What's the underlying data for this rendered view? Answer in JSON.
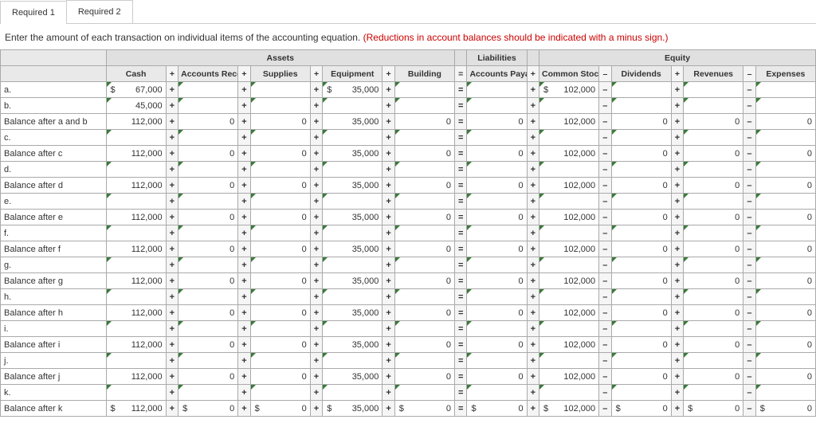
{
  "tabs": {
    "req1": "Required 1",
    "req2": "Required 2"
  },
  "instruction": "Enter the amount of each transaction on individual items of the accounting equation. ",
  "warning": "(Reductions in account balances should be indicated with a minus sign.)",
  "group_headers": {
    "assets": "Assets",
    "liabilities": "Liabilities",
    "equity": "Equity"
  },
  "cols": {
    "cash": "Cash",
    "ar": "Accounts Receivable",
    "supplies": "Supplies",
    "equip": "Equipment",
    "bldg": "Building",
    "ap": "Accounts Payable",
    "cs": "Common Stock",
    "div": "Dividends",
    "rev": "Revenues",
    "exp": "Expenses"
  },
  "ops": {
    "plus": "+",
    "minus": "–",
    "eq": "="
  },
  "currency": "$",
  "rows": [
    {
      "label": "a.",
      "cash": "67,000",
      "cash$": true,
      "ar": "",
      "sup": "",
      "equip": "35,000",
      "equip$": true,
      "bldg": "",
      "ap": "",
      "cs": "102,000",
      "cs$": true,
      "div": "",
      "rev": "",
      "exp": "",
      "tri": true
    },
    {
      "label": "b.",
      "cash": "45,000",
      "ar": "",
      "sup": "",
      "equip": "",
      "bldg": "",
      "ap": "",
      "cs": "",
      "div": "",
      "rev": "",
      "exp": "",
      "tri": true,
      "dotted": true
    },
    {
      "label": "Balance after a and b",
      "cash": "112,000",
      "ar": "0",
      "sup": "0",
      "equip": "35,000",
      "bldg": "0",
      "ap": "0",
      "cs": "102,000",
      "div": "0",
      "rev": "0",
      "exp": "0",
      "tri": false
    },
    {
      "label": "c.",
      "cash": "",
      "ar": "",
      "sup": "",
      "equip": "",
      "bldg": "",
      "ap": "",
      "cs": "",
      "div": "",
      "rev": "",
      "exp": "",
      "tri": true
    },
    {
      "label": "Balance after c",
      "cash": "112,000",
      "ar": "0",
      "sup": "0",
      "equip": "35,000",
      "bldg": "0",
      "ap": "0",
      "cs": "102,000",
      "div": "0",
      "rev": "0",
      "exp": "0",
      "tri": false
    },
    {
      "label": "d.",
      "cash": "",
      "ar": "",
      "sup": "",
      "equip": "",
      "bldg": "",
      "ap": "",
      "cs": "",
      "div": "",
      "rev": "",
      "exp": "",
      "tri": true
    },
    {
      "label": "Balance after d",
      "cash": "112,000",
      "ar": "0",
      "sup": "0",
      "equip": "35,000",
      "bldg": "0",
      "ap": "0",
      "cs": "102,000",
      "div": "0",
      "rev": "0",
      "exp": "0",
      "tri": false
    },
    {
      "label": "e.",
      "cash": "",
      "ar": "",
      "sup": "",
      "equip": "",
      "bldg": "",
      "ap": "",
      "cs": "",
      "div": "",
      "rev": "",
      "exp": "",
      "tri": true
    },
    {
      "label": "Balance after e",
      "cash": "112,000",
      "ar": "0",
      "sup": "0",
      "equip": "35,000",
      "bldg": "0",
      "ap": "0",
      "cs": "102,000",
      "div": "0",
      "rev": "0",
      "exp": "0",
      "tri": false
    },
    {
      "label": "f.",
      "cash": "",
      "ar": "",
      "sup": "",
      "equip": "",
      "bldg": "",
      "ap": "",
      "cs": "",
      "div": "",
      "rev": "",
      "exp": "",
      "tri": true
    },
    {
      "label": "Balance after f",
      "cash": "112,000",
      "ar": "0",
      "sup": "0",
      "equip": "35,000",
      "bldg": "0",
      "ap": "0",
      "cs": "102,000",
      "div": "0",
      "rev": "0",
      "exp": "0",
      "tri": false
    },
    {
      "label": "g.",
      "cash": "",
      "ar": "",
      "sup": "",
      "equip": "",
      "bldg": "",
      "ap": "",
      "cs": "",
      "div": "",
      "rev": "",
      "exp": "",
      "tri": true
    },
    {
      "label": "Balance after g",
      "cash": "112,000",
      "ar": "0",
      "sup": "0",
      "equip": "35,000",
      "bldg": "0",
      "ap": "0",
      "cs": "102,000",
      "div": "0",
      "rev": "0",
      "exp": "0",
      "tri": false
    },
    {
      "label": "h.",
      "cash": "",
      "ar": "",
      "sup": "",
      "equip": "",
      "bldg": "",
      "ap": "",
      "cs": "",
      "div": "",
      "rev": "",
      "exp": "",
      "tri": true
    },
    {
      "label": "Balance after h",
      "cash": "112,000",
      "ar": "0",
      "sup": "0",
      "equip": "35,000",
      "bldg": "0",
      "ap": "0",
      "cs": "102,000",
      "div": "0",
      "rev": "0",
      "exp": "0",
      "tri": false
    },
    {
      "label": "i.",
      "cash": "",
      "ar": "",
      "sup": "",
      "equip": "",
      "bldg": "",
      "ap": "",
      "cs": "",
      "div": "",
      "rev": "",
      "exp": "",
      "tri": true
    },
    {
      "label": "Balance after i",
      "cash": "112,000",
      "ar": "0",
      "sup": "0",
      "equip": "35,000",
      "bldg": "0",
      "ap": "0",
      "cs": "102,000",
      "div": "0",
      "rev": "0",
      "exp": "0",
      "tri": false
    },
    {
      "label": "j.",
      "cash": "",
      "ar": "",
      "sup": "",
      "equip": "",
      "bldg": "",
      "ap": "",
      "cs": "",
      "div": "",
      "rev": "",
      "exp": "",
      "tri": true
    },
    {
      "label": "Balance after j",
      "cash": "112,000",
      "ar": "0",
      "sup": "0",
      "equip": "35,000",
      "bldg": "0",
      "ap": "0",
      "cs": "102,000",
      "div": "0",
      "rev": "0",
      "exp": "0",
      "tri": false
    },
    {
      "label": "k.",
      "cash": "",
      "ar": "",
      "sup": "",
      "equip": "",
      "bldg": "",
      "ap": "",
      "cs": "",
      "div": "",
      "rev": "",
      "exp": "",
      "tri": true
    },
    {
      "label": "Balance after k",
      "cash": "112,000",
      "cash$": true,
      "ar": "0",
      "ar$": true,
      "sup": "0",
      "sup$": true,
      "equip": "35,000",
      "equip$": true,
      "bldg": "0",
      "bldg$": true,
      "ap": "0",
      "ap$": true,
      "cs": "102,000",
      "cs$": true,
      "div": "0",
      "div$": true,
      "rev": "0",
      "rev$": true,
      "exp": "0",
      "exp$": true,
      "tri": false
    }
  ]
}
